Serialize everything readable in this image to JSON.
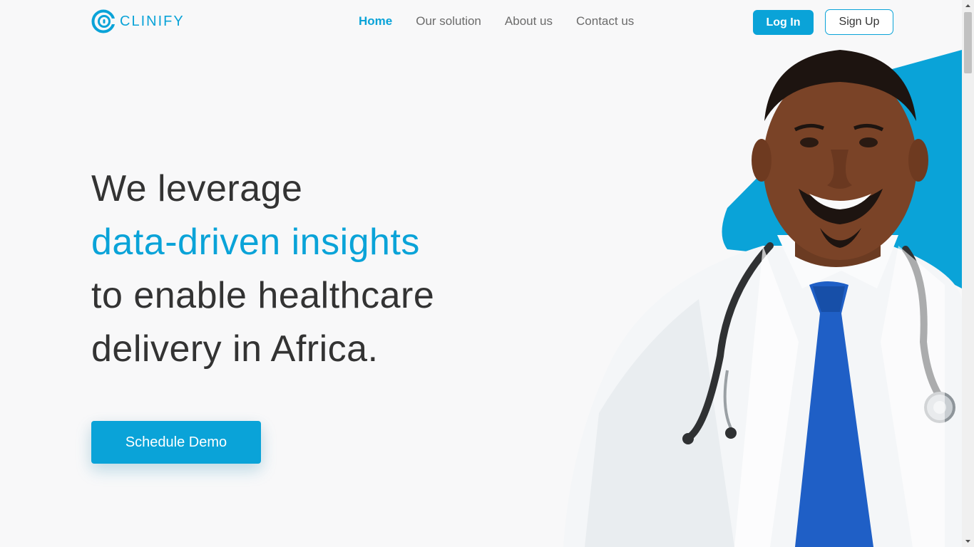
{
  "brand": {
    "name": "CLINIFY",
    "color": "#0aa3d8"
  },
  "nav": {
    "items": [
      {
        "label": "Home",
        "active": true
      },
      {
        "label": "Our solution",
        "active": false
      },
      {
        "label": "About us",
        "active": false
      },
      {
        "label": "Contact us",
        "active": false
      }
    ]
  },
  "auth": {
    "login_label": "Log In",
    "signup_label": "Sign Up"
  },
  "hero": {
    "line1": "We leverage",
    "line2": "data-driven insights",
    "line3": "to enable healthcare",
    "line4": "delivery in Africa."
  },
  "cta": {
    "label": "Schedule Demo"
  },
  "colors": {
    "accent": "#0aa3d8",
    "text": "#333333",
    "muted": "#6b6b6b",
    "background": "#f8f8f9"
  }
}
